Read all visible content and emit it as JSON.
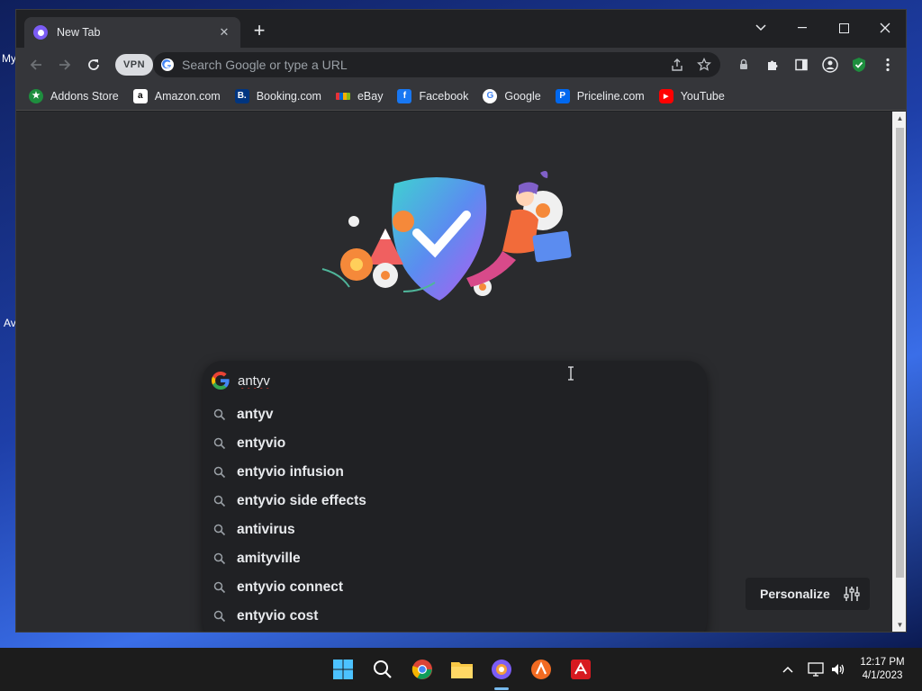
{
  "desktop": {
    "left_labels": [
      "My",
      "Av"
    ]
  },
  "browser": {
    "tab": {
      "title": "New Tab",
      "close": "✕"
    },
    "new_tab": "+",
    "omnibox": {
      "vpn": "VPN",
      "placeholder": "Search Google or type a URL"
    },
    "bookmarks": [
      {
        "label": "Addons Store",
        "icon": "addons-store-icon",
        "color": "#1e8e3e",
        "glyph": "★"
      },
      {
        "label": "Amazon.com",
        "icon": "amazon-icon",
        "color": "#ffffff",
        "glyph": "a"
      },
      {
        "label": "Booking.com",
        "icon": "booking-icon",
        "color": "#003580",
        "glyph": "B."
      },
      {
        "label": "eBay",
        "icon": "ebay-icon",
        "color": "#e53238",
        "glyph": ""
      },
      {
        "label": "Facebook",
        "icon": "facebook-icon",
        "color": "#1877f2",
        "glyph": "f"
      },
      {
        "label": "Google",
        "icon": "google-icon",
        "color": "#ffffff",
        "glyph": "G"
      },
      {
        "label": "Priceline.com",
        "icon": "priceline-icon",
        "color": "#0068ef",
        "glyph": "P"
      },
      {
        "label": "YouTube",
        "icon": "youtube-icon",
        "color": "#ff0000",
        "glyph": "▶"
      }
    ]
  },
  "search": {
    "query": "antyv",
    "suggestions": [
      "antyv",
      "entyvio",
      "entyvio infusion",
      "entyvio side effects",
      "antivirus",
      "amityville",
      "entyvio connect",
      "entyvio cost"
    ]
  },
  "personalize": {
    "label": "Personalize"
  },
  "taskbar": {
    "time": "12:17 PM",
    "date": "4/1/2023"
  },
  "colors": {
    "accent": "#8ab4f8",
    "vpn_badge": "#dadce0",
    "shield_ok": "#1e8e3e"
  }
}
